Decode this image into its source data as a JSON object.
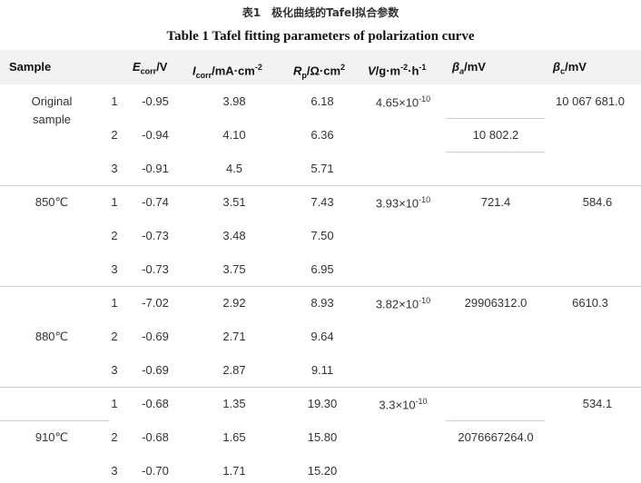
{
  "caption": {
    "cn": "表1　极化曲线的Tafel拟合参数",
    "en": "Table 1  Tafel fitting parameters of polarization curve"
  },
  "headers": {
    "sample": "Sample",
    "ecorr_sym": "E",
    "ecorr_sub": "corr",
    "ecorr_unit": "/V",
    "icorr_sym": "I",
    "icorr_sub": "corr",
    "icorr_unit": "/mA·cm",
    "icorr_exp": "-2",
    "rp_sym": "R",
    "rp_sub": "p",
    "rp_unit": "/Ω·cm",
    "rp_exp": "2",
    "v_sym": "V",
    "v_unit1": "/g·m",
    "v_exp1": "-2",
    "v_unit2": "·h",
    "v_exp2": "-1",
    "ba_sym": "β",
    "ba_sub": "a",
    "ba_unit": "/mV",
    "bc_sym": "β",
    "bc_sub": "c",
    "bc_unit": "/mV"
  },
  "groups": [
    {
      "sample_line1": "Original",
      "sample_line2": "sample",
      "v_base": "4.65×10",
      "v_exp": "-10",
      "beta_a": "10 802.2",
      "beta_c": "10 067 681.0",
      "rows": [
        {
          "n": "1",
          "ecorr": "-0.95",
          "icorr": "3.98",
          "rp": "6.18"
        },
        {
          "n": "2",
          "ecorr": "-0.94",
          "icorr": "4.10",
          "rp": "6.36"
        },
        {
          "n": "3",
          "ecorr": "-0.91",
          "icorr": "4.5",
          "rp": "5.71"
        }
      ]
    },
    {
      "sample_line1": "850℃",
      "v_base": "3.93×10",
      "v_exp": "-10",
      "beta_a": "721.4",
      "beta_c": "584.6",
      "rows": [
        {
          "n": "1",
          "ecorr": "-0.74",
          "icorr": "3.51",
          "rp": "7.43"
        },
        {
          "n": "2",
          "ecorr": "-0.73",
          "icorr": "3.48",
          "rp": "7.50"
        },
        {
          "n": "3",
          "ecorr": "-0.73",
          "icorr": "3.75",
          "rp": "6.95"
        }
      ]
    },
    {
      "sample_line1": "880℃",
      "v_base": "3.82×10",
      "v_exp": "-10",
      "beta_a": "29906312.0",
      "beta_c": "6610.3",
      "rows": [
        {
          "n": "1",
          "ecorr": "-7.02",
          "icorr": "2.92",
          "rp": "8.93"
        },
        {
          "n": "2",
          "ecorr": "-0.69",
          "icorr": "2.71",
          "rp": "9.64"
        },
        {
          "n": "3",
          "ecorr": "-0.69",
          "icorr": "2.87",
          "rp": "9.11"
        }
      ]
    },
    {
      "sample_line1": "910℃",
      "v_base": "3.3×10",
      "v_exp": "-10",
      "beta_a": "2076667264.0",
      "beta_c": "534.1",
      "rows": [
        {
          "n": "1",
          "ecorr": "-0.68",
          "icorr": "1.35",
          "rp": "19.30"
        },
        {
          "n": "2",
          "ecorr": "-0.68",
          "icorr": "1.65",
          "rp": "15.80"
        },
        {
          "n": "3",
          "ecorr": "-0.70",
          "icorr": "1.71",
          "rp": "15.20"
        }
      ]
    }
  ]
}
